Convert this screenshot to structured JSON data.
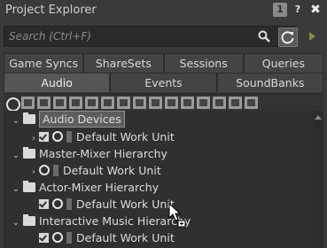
{
  "window": {
    "title": "Project Explorer",
    "counter": "1",
    "help_label": "?",
    "close_label": "✖"
  },
  "search": {
    "placeholder": "Search (Ctrl+F)",
    "value": ""
  },
  "tabs_row1": [
    "Game Syncs",
    "ShareSets",
    "Sessions",
    "Queries"
  ],
  "tabs_row2": [
    "Audio",
    "Events",
    "SoundBanks"
  ],
  "active_tab": "Audio",
  "toolbar": {
    "tool_count": 16
  },
  "tree": [
    {
      "label": "Audio Devices",
      "expanded": true,
      "selected": true
    },
    {
      "label": "Default Work Unit",
      "expanded": false
    },
    {
      "label": "Master-Mixer Hierarchy",
      "expanded": true
    },
    {
      "label": "Default Work Unit",
      "expanded": false
    },
    {
      "label": "Actor-Mixer Hierarchy",
      "expanded": true
    },
    {
      "label": "Default Work Unit"
    },
    {
      "label": "Interactive Music Hierarchy",
      "expanded": true
    },
    {
      "label": "Default Work Unit"
    }
  ],
  "colors": {
    "background": "#3a3a3a",
    "panel": "#303030",
    "active_tab": "#565656",
    "selection": "#5d5d5d"
  }
}
